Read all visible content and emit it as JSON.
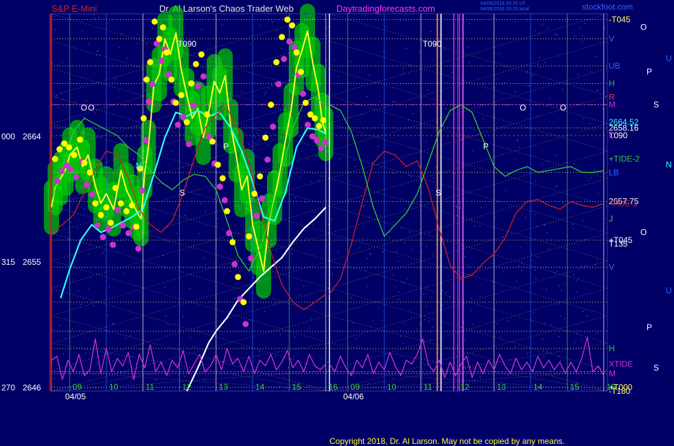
{
  "header": {
    "symbol": "S&P E-Mini",
    "author": "Dr. Al Larson's Chaos Trader Web",
    "site": "Daytradingforecasts.com",
    "stamp1": "04/06/2018 20:20 UT",
    "stamp2": "04/06/2018 16:20 local",
    "corner": "stockfoot.com"
  },
  "footer": {
    "copyright": "Copyright 2018, Dr. Al Larson. May not be copied by any means."
  },
  "colors": {
    "background": "#000066",
    "price": "#ffff33",
    "mov_avg": "#33ffff",
    "tide1": "#cc2222",
    "tide2": "#33cc33",
    "xtide": "#cc33cc",
    "long_avg": "#ffffff",
    "marker": "#ffff00",
    "flow": "#cc33cc",
    "grid": "#ffff66",
    "field": "#00cc00"
  },
  "chart_data": {
    "type": "line",
    "title": "S&P E-Mini",
    "days": [
      "04/05",
      "04/06"
    ],
    "hour_ticks": [
      "09",
      "10",
      "11",
      "12",
      "13",
      "14",
      "15",
      "16",
      "09",
      "10",
      "11",
      "12",
      "13",
      "14",
      "15",
      "16"
    ],
    "left_axis": [
      {
        "prefix": "000",
        "price": 2664
      },
      {
        "prefix": "315",
        "price": 2655
      },
      {
        "prefix": "270",
        "price": 2646
      }
    ],
    "ylim": [
      2646,
      2665.5
    ],
    "right_labels": [
      {
        "text": "-T045",
        "price": 2665.2,
        "color": "#ffff66"
      },
      {
        "text": "V",
        "price": 2664.2,
        "color": "#3366ff"
      },
      {
        "text": "UB",
        "price": 2662.8,
        "color": "#3366ff"
      },
      {
        "text": "H",
        "price": 2661.9,
        "color": "#33cc33"
      },
      {
        "text": "R",
        "price": 2661.2,
        "color": "#ff3333"
      },
      {
        "text": "M",
        "price": 2660.8,
        "color": "#cc33cc"
      },
      {
        "text": "2664.52",
        "price": 2659.9,
        "color": "#33ffff"
      },
      {
        "text": "2658.16",
        "price": 2659.6,
        "color": "#ffffff"
      },
      {
        "text": "T090",
        "price": 2659.2,
        "color": "#ffffff"
      },
      {
        "text": "C",
        "price": 2659.2,
        "color": "#cc33cc"
      },
      {
        "text": "+TIDE-2",
        "price": 2658.0,
        "color": "#33cc33"
      },
      {
        "text": "LB",
        "price": 2657.3,
        "color": "#3366ff"
      },
      {
        "text": "2657.75",
        "price": 2655.8,
        "color": "#ffffff"
      },
      {
        "text": "-TIDE-1",
        "price": 2655.7,
        "color": "#cc2222"
      },
      {
        "text": "J",
        "price": 2654.9,
        "color": "#33cc33"
      },
      {
        "text": "+T045",
        "price": 2653.8,
        "color": "#ffffff"
      },
      {
        "text": "T135",
        "price": 2653.6,
        "color": "#ffffff"
      },
      {
        "text": "V",
        "price": 2652.4,
        "color": "#3366ff"
      },
      {
        "text": "H",
        "price": 2648.2,
        "color": "#33cc33"
      },
      {
        "text": "XTIDE",
        "price": 2647.4,
        "color": "#cc33cc"
      },
      {
        "text": "M",
        "price": 2646.9,
        "color": "#cc33cc"
      },
      {
        "text": "+T000",
        "price": 2646.2,
        "color": "#ffff66"
      },
      {
        "text": "-T180",
        "price": 2646.0,
        "color": "#ffff66"
      }
    ],
    "far_right_labels": [
      {
        "text": "O",
        "price": 2664.8,
        "color": "#ffffff"
      },
      {
        "text": "U",
        "price": 2663.2,
        "color": "#3366ff"
      },
      {
        "text": "P",
        "price": 2662.5,
        "color": "#ffffff"
      },
      {
        "text": "S",
        "price": 2660.8,
        "color": "#ffffff"
      },
      {
        "text": "N",
        "price": 2657.7,
        "color": "#33ffff"
      },
      {
        "text": "O",
        "price": 2654.2,
        "color": "#ffffff"
      },
      {
        "text": "U",
        "price": 2651.2,
        "color": "#3366ff"
      },
      {
        "text": "P",
        "price": 2649.3,
        "color": "#ffffff"
      },
      {
        "text": "S",
        "price": 2647.2,
        "color": "#ffffff"
      }
    ],
    "in_chart_labels": [
      {
        "text": "O",
        "color": "#ffffff",
        "x": 9.3,
        "price": 2660.5
      },
      {
        "text": "O",
        "color": "#ffffff",
        "x": 14.8,
        "price": 2660.5
      },
      {
        "text": "O",
        "color": "#ffffff",
        "x": 9.5,
        "price": 2660.5
      },
      {
        "text": "O",
        "color": "#ffffff",
        "x": 13.7,
        "price": 2660.5
      },
      {
        "text": "P",
        "color": "#ffffff",
        "x": 13.2,
        "price": 2658.5
      },
      {
        "text": "P",
        "color": "#ffffff",
        "x": 12.7,
        "price": 2658.5
      },
      {
        "text": "S",
        "color": "#ffffff",
        "x": 12.0,
        "price": 2656.1
      },
      {
        "text": "S",
        "color": "#ffffff",
        "x": 11.4,
        "price": 2656.1
      },
      {
        "text": "N",
        "color": "#33ffff",
        "x": 10.8,
        "price": 2657.5
      },
      {
        "text": "T090",
        "color": "#ffffff",
        "x": 11.05,
        "price": 2663.8
      },
      {
        "text": "T090",
        "color": "#ffffff",
        "x": 11.95,
        "price": 2663.8
      }
    ],
    "series": [
      {
        "name": "Price",
        "day": 0,
        "kind": "price",
        "x": [
          8.5,
          8.6,
          8.75,
          8.9,
          9.0,
          9.2,
          9.35,
          9.5,
          9.7,
          9.85,
          10.0,
          10.2,
          10.4,
          10.55,
          10.7,
          10.85,
          10.95,
          11.05,
          11.15,
          11.3,
          11.45,
          11.6,
          11.75,
          11.9,
          12.05,
          12.2,
          12.35,
          12.5,
          12.65,
          12.8,
          12.95,
          13.1,
          13.25,
          13.4,
          13.55,
          13.7,
          13.85,
          14.0,
          14.15,
          14.3,
          14.45,
          14.6,
          14.75,
          14.9,
          15.05,
          15.2,
          15.35,
          15.5,
          15.65,
          15.8,
          15.9,
          16.0
        ],
        "y": [
          2655.5,
          2656.5,
          2657,
          2657.5,
          2658.2,
          2658.6,
          2657.6,
          2658.2,
          2656.6,
          2655.7,
          2656.2,
          2655.4,
          2657.4,
          2656.4,
          2655.8,
          2655.2,
          2654.9,
          2657.3,
          2658.6,
          2661.8,
          2662.4,
          2664.2,
          2663.4,
          2664.5,
          2662.6,
          2661.3,
          2660.1,
          2660.6,
          2659.1,
          2660.4,
          2662.0,
          2661.4,
          2662.3,
          2659.7,
          2658.2,
          2656.4,
          2657.1,
          2654.6,
          2653.4,
          2652.2,
          2654.8,
          2656.0,
          2657.4,
          2659.0,
          2660.5,
          2662.7,
          2663.6,
          2664.6,
          2662.9,
          2661.5,
          2660.0,
          2659.3
        ]
      },
      {
        "name": "Average",
        "day": 0,
        "kind": "avg",
        "x": [
          8.75,
          9.0,
          9.3,
          9.6,
          9.85,
          10.1,
          10.4,
          10.7,
          11.0,
          11.3,
          11.6,
          11.9,
          12.2,
          12.5,
          12.8,
          13.1,
          13.4,
          13.7,
          14.0,
          14.3,
          14.6,
          14.9,
          15.2,
          15.5,
          15.8,
          16.0
        ],
        "y": [
          2650.8,
          2652.3,
          2653.8,
          2654.6,
          2654.2,
          2654.4,
          2654.7,
          2655.0,
          2655.4,
          2657.2,
          2659.1,
          2660.4,
          2660.2,
          2660.5,
          2660.2,
          2660.4,
          2659.6,
          2658.4,
          2656.8,
          2655.0,
          2654.8,
          2656.3,
          2658.6,
          2659.6,
          2659.5,
          2659.3
        ]
      },
      {
        "name": "Long Average",
        "day": 0,
        "kind": "long",
        "x": [
          12.2,
          12.5,
          12.8,
          13.0,
          13.3,
          13.6,
          13.9,
          14.2,
          14.5,
          14.8,
          15.1,
          15.4,
          15.7,
          16.0
        ],
        "y": [
          2646.0,
          2647.2,
          2648.5,
          2649.1,
          2649.8,
          2650.7,
          2651.3,
          2651.9,
          2652.4,
          2652.9,
          2653.7,
          2654.4,
          2654.9,
          2655.5
        ]
      },
      {
        "name": "TIDE-1",
        "day": 0,
        "kind": "tide1",
        "x": [
          8.5,
          8.8,
          9.1,
          9.4,
          9.7,
          10.0,
          10.3,
          10.6,
          10.9,
          11.2,
          11.5,
          11.8,
          12.1,
          12.4,
          12.7,
          13.0,
          13.3,
          13.6,
          13.9,
          14.2,
          14.5,
          14.8,
          15.1,
          15.4,
          15.7,
          16.0
        ],
        "y": [
          2654.2,
          2654.6,
          2655.1,
          2656.3,
          2657.5,
          2658.4,
          2658.2,
          2657.0,
          2655.4,
          2654.6,
          2654.2,
          2654.8,
          2656.2,
          2658.0,
          2659.6,
          2660.3,
          2660.6,
          2659.6,
          2657.8,
          2655.4,
          2653.2,
          2651.5,
          2650.6,
          2650.2,
          2650.6,
          2651.0
        ]
      },
      {
        "name": "TIDE-1 (04/06)",
        "day": 1,
        "kind": "tide1",
        "x": [
          8.5,
          8.8,
          9.1,
          9.4,
          9.7,
          10.0,
          10.3,
          10.6,
          10.9,
          11.2,
          11.5,
          11.8,
          12.1,
          12.4,
          12.7,
          13.0,
          13.3,
          13.6,
          13.9,
          14.2,
          14.5,
          14.8,
          15.1,
          15.4,
          15.7,
          16.0
        ],
        "y": [
          2651.0,
          2651.8,
          2653.6,
          2655.8,
          2657.8,
          2658.4,
          2658.2,
          2657.6,
          2657.9,
          2656.5,
          2654.4,
          2652.5,
          2651.8,
          2652.0,
          2652.6,
          2653.1,
          2653.9,
          2655.2,
          2655.8,
          2655.9,
          2655.6,
          2655.4,
          2655.8,
          2655.6,
          2655.5,
          2655.7
        ]
      },
      {
        "name": "TIDE-2",
        "day": 0,
        "kind": "tide2",
        "x": [
          8.5,
          8.8,
          9.1,
          9.4,
          9.7,
          10.0,
          10.3,
          10.6,
          10.9,
          11.2,
          11.5,
          11.8,
          12.1,
          12.4,
          12.7,
          13.0,
          13.3,
          13.6,
          13.9,
          14.2,
          14.5,
          14.8,
          15.1,
          15.4,
          15.7,
          16.0
        ],
        "y": [
          2655.8,
          2657.6,
          2659.4,
          2660.1,
          2659.8,
          2659.5,
          2659.2,
          2658.6,
          2658.2,
          2657.4,
          2656.8,
          2656.4,
          2656.9,
          2657.2,
          2657.1,
          2656.4,
          2654.8,
          2653.0,
          2652.2,
          2653.4,
          2655.2,
          2657.3,
          2659.6,
          2660.9,
          2661.2,
          2660.8
        ]
      },
      {
        "name": "TIDE-2 (04/06)",
        "day": 1,
        "kind": "tide2",
        "x": [
          8.5,
          8.8,
          9.1,
          9.4,
          9.7,
          10.0,
          10.3,
          10.6,
          10.9,
          11.2,
          11.5,
          11.8,
          12.1,
          12.4,
          12.7,
          13.0,
          13.3,
          13.6,
          13.9,
          14.2,
          14.5,
          14.8,
          15.1,
          15.4,
          15.7,
          16.0
        ],
        "y": [
          2660.8,
          2660.5,
          2659.4,
          2657.6,
          2655.5,
          2654.0,
          2654.6,
          2655.2,
          2656.2,
          2657.8,
          2659.4,
          2660.5,
          2660.8,
          2660.4,
          2659.0,
          2657.6,
          2657.1,
          2657.4,
          2657.6,
          2657.3,
          2657.4,
          2657.5,
          2657.6,
          2657.3,
          2657.3,
          2657.4
        ]
      },
      {
        "name": "XTIDE",
        "day": 0,
        "kind": "xtide",
        "x": [
          8.5,
          8.65,
          8.8,
          8.95,
          9.1,
          9.25,
          9.4,
          9.55,
          9.7,
          9.85,
          10.0,
          10.15,
          10.3,
          10.45,
          10.6,
          10.75,
          10.9,
          11.05,
          11.2,
          11.35,
          11.5,
          11.65,
          11.8,
          11.95,
          12.1,
          12.25,
          12.4,
          12.55,
          12.7,
          12.85,
          13.0,
          13.15,
          13.3,
          13.45,
          13.6,
          13.75,
          13.9,
          14.05,
          14.2,
          14.35,
          14.5,
          14.65,
          14.8,
          14.95,
          15.1,
          15.25,
          15.4,
          15.55,
          15.7,
          15.85,
          16.0
        ],
        "y": [
          2647.6,
          2647.8,
          2646.6,
          2647.6,
          2647.0,
          2647.9,
          2646.8,
          2647.1,
          2648.7,
          2646.9,
          2648.2,
          2647.0,
          2647.7,
          2647.3,
          2648.0,
          2646.6,
          2647.9,
          2647.2,
          2648.4,
          2647.0,
          2647.5,
          2646.8,
          2647.6,
          2647.2,
          2648.1,
          2646.9,
          2647.4,
          2647.9,
          2647.0,
          2647.3,
          2647.9,
          2647.1,
          2648.2,
          2647.4,
          2647.7,
          2647.0,
          2647.8,
          2646.9,
          2647.6,
          2647.3,
          2647.9,
          2647.1,
          2647.5,
          2648.1,
          2647.2,
          2647.6,
          2647.0,
          2647.9,
          2647.3,
          2647.1,
          2647.4
        ]
      },
      {
        "name": "XTIDE (04/06)",
        "day": 1,
        "kind": "xtide",
        "x": [
          8.5,
          8.65,
          8.8,
          8.95,
          9.1,
          9.25,
          9.4,
          9.55,
          9.7,
          9.85,
          10.0,
          10.15,
          10.3,
          10.45,
          10.6,
          10.75,
          10.9,
          11.05,
          11.2,
          11.35,
          11.5,
          11.65,
          11.8,
          11.95,
          12.1,
          12.25,
          12.4,
          12.55,
          12.7,
          12.85,
          13.0,
          13.15,
          13.3,
          13.45,
          13.6,
          13.75,
          13.9,
          14.05,
          14.2,
          14.35,
          14.5,
          14.65,
          14.8,
          14.95,
          15.1,
          15.25,
          15.4,
          15.55,
          15.7,
          15.85,
          16.0
        ],
        "y": [
          2647.4,
          2647.0,
          2647.8,
          2647.2,
          2646.8,
          2647.6,
          2647.2,
          2647.9,
          2646.9,
          2647.5,
          2647.1,
          2648.0,
          2647.3,
          2646.8,
          2647.6,
          2647.4,
          2647.9,
          2648.7,
          2647.4,
          2647.0,
          2647.6,
          2646.7,
          2647.5,
          2646.8,
          2647.4,
          2647.8,
          2646.7,
          2647.5,
          2646.9,
          2647.6,
          2647.1,
          2647.9,
          2647.3,
          2646.9,
          2647.7,
          2647.1,
          2647.5,
          2647.0,
          2647.8,
          2647.2,
          2647.6,
          2647.1,
          2647.5,
          2646.9,
          2647.5,
          2647.0,
          2647.7,
          2648.8,
          2647.0,
          2647.3,
          2646.8
        ]
      }
    ],
    "markers": {
      "x": [
        8.6,
        8.72,
        8.85,
        8.98,
        9.12,
        9.28,
        9.4,
        9.55,
        9.7,
        9.85,
        10.0,
        10.12,
        10.25,
        10.4,
        10.55,
        10.7,
        10.82,
        10.92,
        11.02,
        11.1,
        11.2,
        11.32,
        11.45,
        11.55,
        11.65,
        11.78,
        11.9,
        12.05,
        12.2,
        12.32,
        12.45,
        12.6,
        12.75,
        12.9,
        13.05,
        13.18,
        13.3,
        13.45,
        13.6,
        13.75,
        13.9,
        14.05,
        14.2,
        14.35,
        14.5,
        14.65,
        14.8,
        14.95,
        15.08,
        15.2,
        15.32,
        15.45,
        15.58,
        15.7,
        15.82,
        15.93
      ],
      "y": [
        2657.5,
        2658.0,
        2658.3,
        2658.1,
        2657.7,
        2658.5,
        2657.3,
        2656.8,
        2655.2,
        2654.6,
        2655.0,
        2654.2,
        2656.0,
        2655.2,
        2654.8,
        2655.1,
        2654.0,
        2657.0,
        2659.6,
        2661.6,
        2662.5,
        2664.6,
        2663.7,
        2664.3,
        2663.0,
        2661.6,
        2660.4,
        2660.8,
        2659.4,
        2661.4,
        2662.4,
        2662.9,
        2659.8,
        2658.4,
        2657.2,
        2656.5,
        2654.8,
        2653.2,
        2651.4,
        2650.1,
        2653.5,
        2655.7,
        2656.6,
        2658.6,
        2660.3,
        2662.5,
        2663.8,
        2664.7,
        2664.4,
        2663.0,
        2662.0,
        2660.4,
        2659.8,
        2659.6,
        2659.2,
        2659.5
      ]
    }
  }
}
